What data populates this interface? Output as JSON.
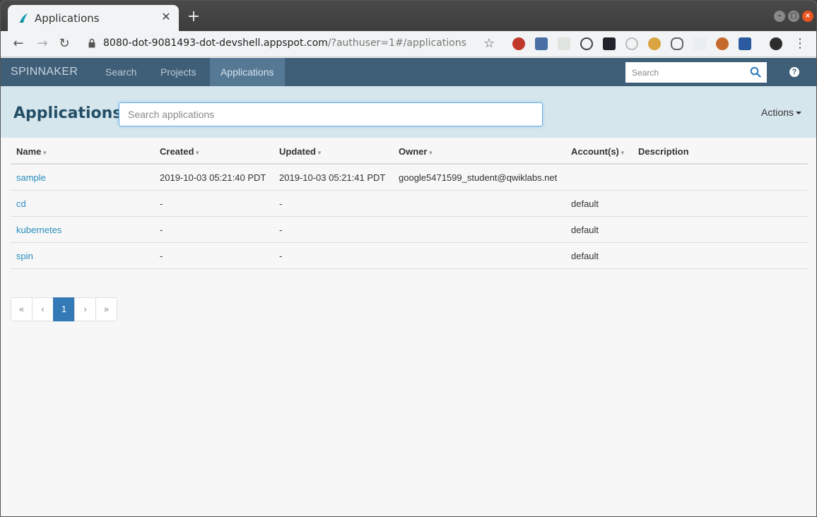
{
  "browser": {
    "tab_title": "Applications",
    "url_main": "8080-dot-9081493-dot-devshell.appspot.com",
    "url_rest": "/?authuser=1#/applications"
  },
  "nav": {
    "brand": "SPINNAKER",
    "links": [
      "Search",
      "Projects",
      "Applications"
    ],
    "active": "Applications",
    "search_placeholder": "Search",
    "help_label": "?"
  },
  "page": {
    "title": "Applications",
    "search_placeholder": "Search applications",
    "actions_label": "Actions"
  },
  "table": {
    "columns": [
      "Name",
      "Created",
      "Updated",
      "Owner",
      "Account(s)",
      "Description"
    ],
    "rows": [
      {
        "name": "sample",
        "created": "2019-10-03 05:21:40 PDT",
        "updated": "2019-10-03 05:21:41 PDT",
        "owner": "google5471599_student@qwiklabs.net",
        "accounts": "",
        "description": ""
      },
      {
        "name": "cd",
        "created": "-",
        "updated": "-",
        "owner": "",
        "accounts": "default",
        "description": ""
      },
      {
        "name": "kubernetes",
        "created": "-",
        "updated": "-",
        "owner": "",
        "accounts": "default",
        "description": ""
      },
      {
        "name": "spin",
        "created": "-",
        "updated": "-",
        "owner": "",
        "accounts": "default",
        "description": ""
      }
    ]
  },
  "pagination": {
    "first": "«",
    "prev": "‹",
    "current": "1",
    "next": "›",
    "last": "»"
  },
  "colors": {
    "nav_bg": "#3f5e77",
    "nav_active": "#557894",
    "header_band": "#d6e6ed",
    "link": "#2a8dbd",
    "pager_active": "#337ab7"
  }
}
